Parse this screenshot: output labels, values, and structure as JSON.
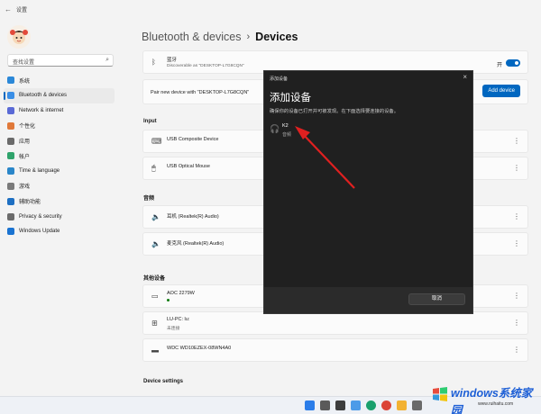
{
  "window": {
    "title": "设置",
    "back_glyph": "←"
  },
  "sidebar": {
    "search_placeholder": "查找设置",
    "items": [
      {
        "label": "系统",
        "icon": "monitor-icon",
        "color": "#2b88d8",
        "selected": false
      },
      {
        "label": "Bluetooth & devices",
        "icon": "bluetooth-icon",
        "color": "#3a8ee6",
        "selected": true
      },
      {
        "label": "Network & internet",
        "icon": "network-icon",
        "color": "#5a6ad6",
        "selected": false
      },
      {
        "label": "个性化",
        "icon": "brush-icon",
        "color": "#e0793a",
        "selected": false
      },
      {
        "label": "应用",
        "icon": "apps-icon",
        "color": "#6a6a6a",
        "selected": false
      },
      {
        "label": "帐户",
        "icon": "account-icon",
        "color": "#2fa36b",
        "selected": false
      },
      {
        "label": "Time & language",
        "icon": "globe-clock-icon",
        "color": "#2a86c9",
        "selected": false
      },
      {
        "label": "游戏",
        "icon": "gamepad-icon",
        "color": "#7a7a7a",
        "selected": false
      },
      {
        "label": "辅助功能",
        "icon": "accessibility-icon",
        "color": "#1e6fc2",
        "selected": false
      },
      {
        "label": "Privacy & security",
        "icon": "shield-icon",
        "color": "#6b6b6b",
        "selected": false
      },
      {
        "label": "Windows Update",
        "icon": "update-icon",
        "color": "#1a73d1",
        "selected": false
      }
    ]
  },
  "breadcrumb": {
    "parent": "Bluetooth & devices",
    "separator": "›",
    "current": "Devices"
  },
  "bluetooth": {
    "label": "蓝牙",
    "sub": "Discoverable as \"DESKTOP-L7G8CQN\"",
    "toggle_label": "开",
    "toggle_on": true
  },
  "pair": {
    "label": "Pair new device with \"DESKTOP-L7G8CQN\"",
    "button": "Add device"
  },
  "sections": {
    "input": "Input",
    "audio": "音频",
    "other": "其他设备",
    "settings": "Device settings"
  },
  "devices": {
    "input": [
      {
        "name": "USB Composite Device",
        "icon": "keyboard-icon"
      },
      {
        "name": "USB Optical Mouse",
        "icon": "mouse-icon"
      }
    ],
    "audio": [
      {
        "name": "耳机 (Realtek(R) Audio)",
        "icon": "speaker-icon"
      },
      {
        "name": "麦克风 (Realtek(R) Audio)",
        "icon": "speaker-icon"
      }
    ],
    "other": [
      {
        "name": "AOC 2279W",
        "sub": "",
        "icon": "monitor-icon"
      },
      {
        "name": "LU-PC: lu:",
        "sub": "未连接",
        "icon": "network-device-icon"
      },
      {
        "name": "WDC WD10EZEX-08WN4A0",
        "sub": "",
        "icon": "drive-icon"
      }
    ]
  },
  "more_glyph": "⋮",
  "dialog": {
    "title": "添加设备",
    "heading": "添加设备",
    "description": "确保你的设备已打开并可被发现。在下面选择要连接的设备。",
    "device": {
      "name": "K2",
      "type": "音频",
      "icon": "headset-icon"
    },
    "cancel": "取消",
    "close_glyph": "×"
  },
  "annotation": {
    "color": "#e02020"
  },
  "watermark": {
    "title": "windows系统家园",
    "url": "www.ruihaitu.com"
  },
  "taskbar": {
    "icons": [
      {
        "name": "start-icon",
        "color": "#2b7de9"
      },
      {
        "name": "search-icon",
        "color": "#5a5a5a"
      },
      {
        "name": "taskview-icon",
        "color": "#3d3d3d"
      },
      {
        "name": "widgets-icon",
        "color": "#4c9be8"
      },
      {
        "name": "edge-icon",
        "color": "#1aa06d"
      },
      {
        "name": "chrome-icon",
        "color": "#db4437"
      },
      {
        "name": "explorer-icon",
        "color": "#f2b233"
      },
      {
        "name": "settings-icon",
        "color": "#6a6a6a"
      }
    ]
  }
}
